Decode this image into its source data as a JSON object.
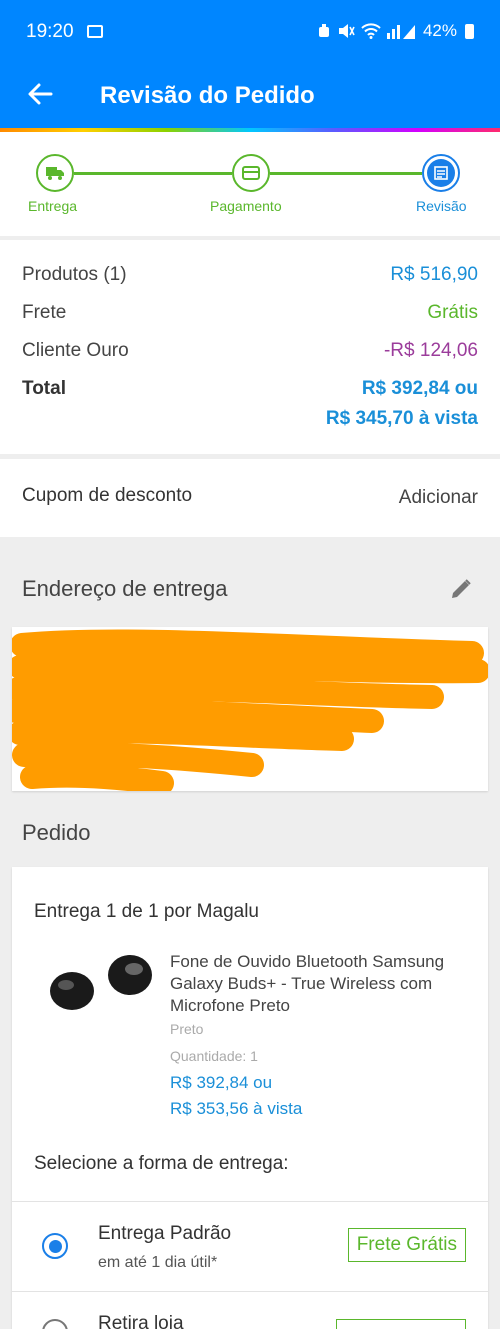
{
  "status_bar": {
    "time": "19:20",
    "battery": "42%"
  },
  "app_bar": {
    "title": "Revisão do Pedido"
  },
  "steps": [
    {
      "label": "Entrega",
      "icon": "truck-icon"
    },
    {
      "label": "Pagamento",
      "icon": "card-icon"
    },
    {
      "label": "Revisão",
      "icon": "review-icon"
    }
  ],
  "summary": {
    "products_label": "Produtos (1)",
    "products_value": "R$ 516,90",
    "shipping_label": "Frete",
    "shipping_value": "Grátis",
    "gold_label": "Cliente Ouro",
    "gold_value": "-R$ 124,06",
    "total_label": "Total",
    "total_value": "R$ 392,84 ou",
    "total_cash": "R$ 345,70 à vista"
  },
  "coupon": {
    "label": "Cupom de desconto",
    "action": "Adicionar"
  },
  "address": {
    "title": "Endereço de entrega"
  },
  "order": {
    "title": "Pedido",
    "seller": "Entrega 1 de 1 por Magalu",
    "product_name": "Fone de Ouvido Bluetooth Samsung Galaxy Buds+ - True Wireless com Microfone Preto",
    "product_color": "Preto",
    "product_qty": "Quantidade:  1",
    "product_price": "R$ 392,84 ou",
    "product_cash": "R$ 353,56 à vista",
    "delivery_title": "Selecione a forma de entrega:",
    "options": [
      {
        "title": "Entrega Padrão",
        "subtitle": "em até 1 dia útil*",
        "badge": "Frete Grátis"
      },
      {
        "title": "Retira loja"
      }
    ]
  },
  "colors": {
    "primary": "#0086ff",
    "green": "#5ab72c",
    "blue_text": "#1a8fd8",
    "purple": "#9b3c9b",
    "redaction": "#ff9c00"
  }
}
